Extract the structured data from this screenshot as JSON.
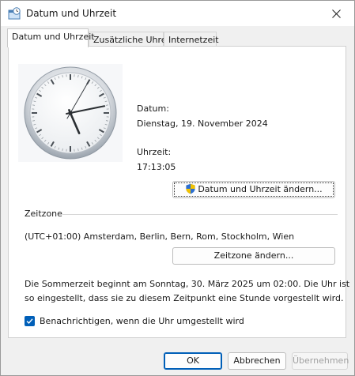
{
  "window": {
    "title": "Datum und Uhrzeit",
    "close_glyph": "✕"
  },
  "tabs": [
    {
      "label": "Datum und Uhrzeit",
      "active": true
    },
    {
      "label": "Zusätzliche Uhren",
      "active": false
    },
    {
      "label": "Internetzeit",
      "active": false
    }
  ],
  "datetime": {
    "date_label": "Datum:",
    "date_value": "Dienstag, 19. November 2024",
    "time_label": "Uhrzeit:",
    "time_value": "17:13:05",
    "change_button": "Datum und Uhrzeit ändern..."
  },
  "clock": {
    "hours": 17,
    "minutes": 13,
    "seconds": 5
  },
  "timezone": {
    "section_label": "Zeitzone",
    "value": "(UTC+01:00) Amsterdam, Berlin, Bern, Rom, Stockholm, Wien",
    "change_button": "Zeitzone ändern..."
  },
  "dst": {
    "line1": "Die Sommerzeit beginnt am Sonntag, 30. März 2025 um 02:00. Die Uhr ist",
    "line2": "so eingestellt, dass sie zu diesem Zeitpunkt eine Stunde vorgestellt wird."
  },
  "notify": {
    "checked": true,
    "label": "Benachrichtigen, wenn die Uhr umgestellt wird"
  },
  "buttons": {
    "ok": "OK",
    "cancel": "Abbrechen",
    "apply": "Übernehmen"
  },
  "colors": {
    "accent": "#005fb8",
    "shield_blue": "#2c6fd1",
    "shield_yellow": "#f2c200"
  }
}
